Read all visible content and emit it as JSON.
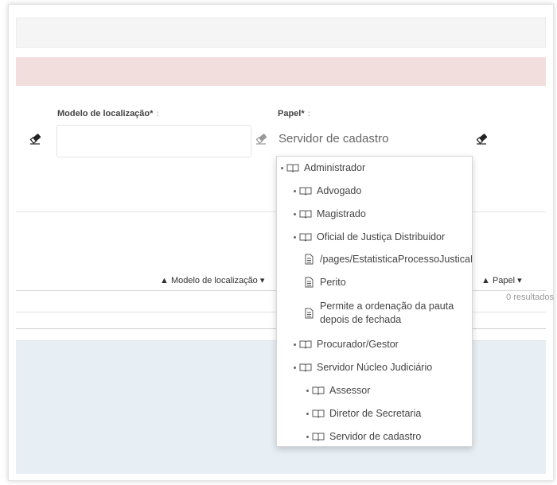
{
  "form": {
    "modelo_label": "Modelo de localização*",
    "papel_label": "Papel*",
    "papel_value": "Servidor de cadastro"
  },
  "table": {
    "col_modelo": "Modelo de localização",
    "col_papel": "Papel",
    "results": "0 resultados"
  },
  "dropdown": {
    "items": [
      {
        "label": "Administrador",
        "kind": "folder",
        "level": 0
      },
      {
        "label": "Advogado",
        "kind": "folder",
        "level": 1
      },
      {
        "label": "Magistrado",
        "kind": "folder",
        "level": 1
      },
      {
        "label": "Oficial de Justiça Distribuidor",
        "kind": "folder",
        "level": 1
      },
      {
        "label": "/pages/EstatisticaProcessoJusticaFederal/Process",
        "kind": "doc",
        "level": 2
      },
      {
        "label": "Perito",
        "kind": "doc",
        "level": 2
      },
      {
        "label": "Permite a ordenação da pauta depois de fechada",
        "kind": "doc",
        "level": 2
      },
      {
        "label": "Procurador/Gestor",
        "kind": "folder",
        "level": 1
      },
      {
        "label": "Servidor Núcleo Judiciário",
        "kind": "folder",
        "level": 1
      },
      {
        "label": "Assessor",
        "kind": "folder",
        "level": 2
      },
      {
        "label": "Diretor de Secretaria",
        "kind": "folder",
        "level": 2
      },
      {
        "label": "Servidor de cadastro",
        "kind": "folder",
        "level": 2
      }
    ]
  }
}
